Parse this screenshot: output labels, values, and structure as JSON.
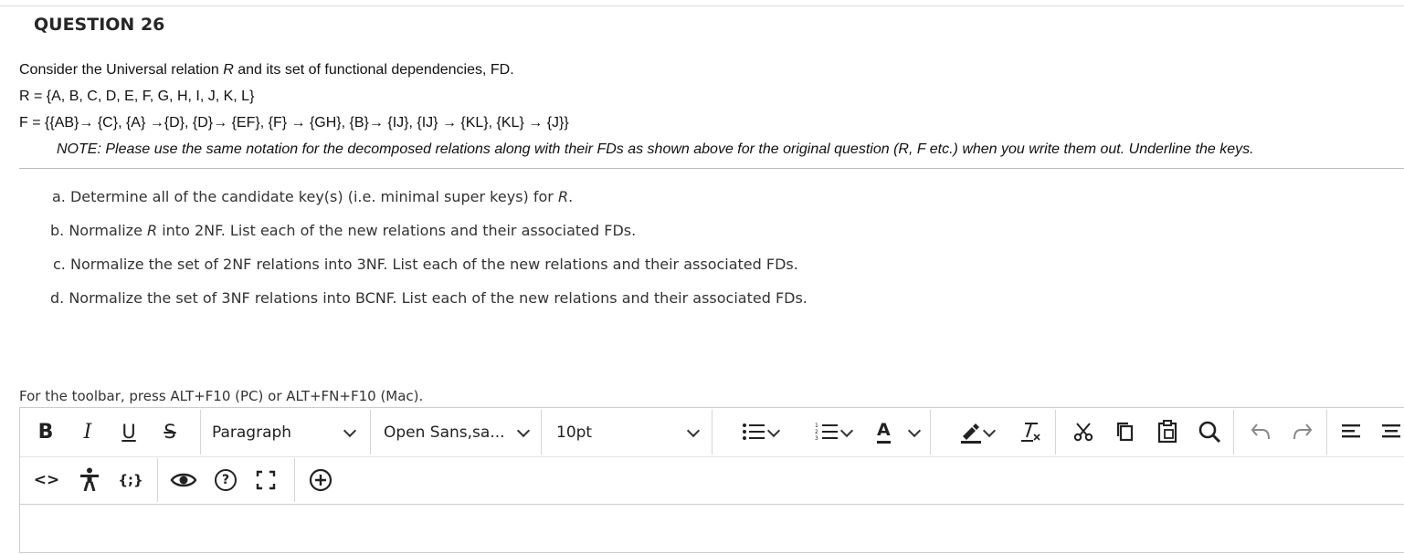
{
  "question": {
    "title": "QUESTION 26",
    "intro": "Consider the Universal relation R and its set of functional dependencies, FD.",
    "intro_parts": {
      "before": "Consider the Universal relation ",
      "italic": "R",
      "after": " and its set of functional dependencies, FD."
    },
    "relation": "R = {A, B, C, D, E, F, G, H, I, J, K, L}",
    "fds": "F = {{AB}→ {C}, {A} →{D}, {D}→ {EF}, {F} → {GH}, {B}→ {IJ}, {IJ} →  {KL}, {KL} →  {J}}",
    "note": "NOTE: Please use the same notation for the decomposed relations along with their FDs as shown above for the original question (R, F etc.) when you write them out. Underline the keys.",
    "parts": [
      {
        "prefix": "a. Determine all of the candidate key(s) (i.e. minimal super keys) for ",
        "italic": "R",
        "suffix": "."
      },
      {
        "prefix": "b. Normalize ",
        "italic": "R",
        "suffix": " into 2NF. List each of the new relations and their associated FDs."
      },
      {
        "prefix": "c. Normalize the set of 2NF relations into 3NF. List each of the new relations and their associated FDs.",
        "italic": "",
        "suffix": ""
      },
      {
        "prefix": "d. Normalize the set of 3NF relations into BCNF. List each of the new relations and their associated FDs.",
        "italic": "",
        "suffix": ""
      }
    ]
  },
  "editor": {
    "toolbar_hint": "For the toolbar, press ALT+F10 (PC) or ALT+FN+F10 (Mac).",
    "bold_label": "B",
    "italic_label": "I",
    "underline_label": "U",
    "strike_label": "S",
    "format_select": "Paragraph",
    "font_select": "Open Sans,sa...",
    "size_select": "10pt",
    "font_color_label": "A",
    "code_label": "<>",
    "embed_label": "{;}",
    "help_label": "?",
    "accent_color": "#222222"
  }
}
